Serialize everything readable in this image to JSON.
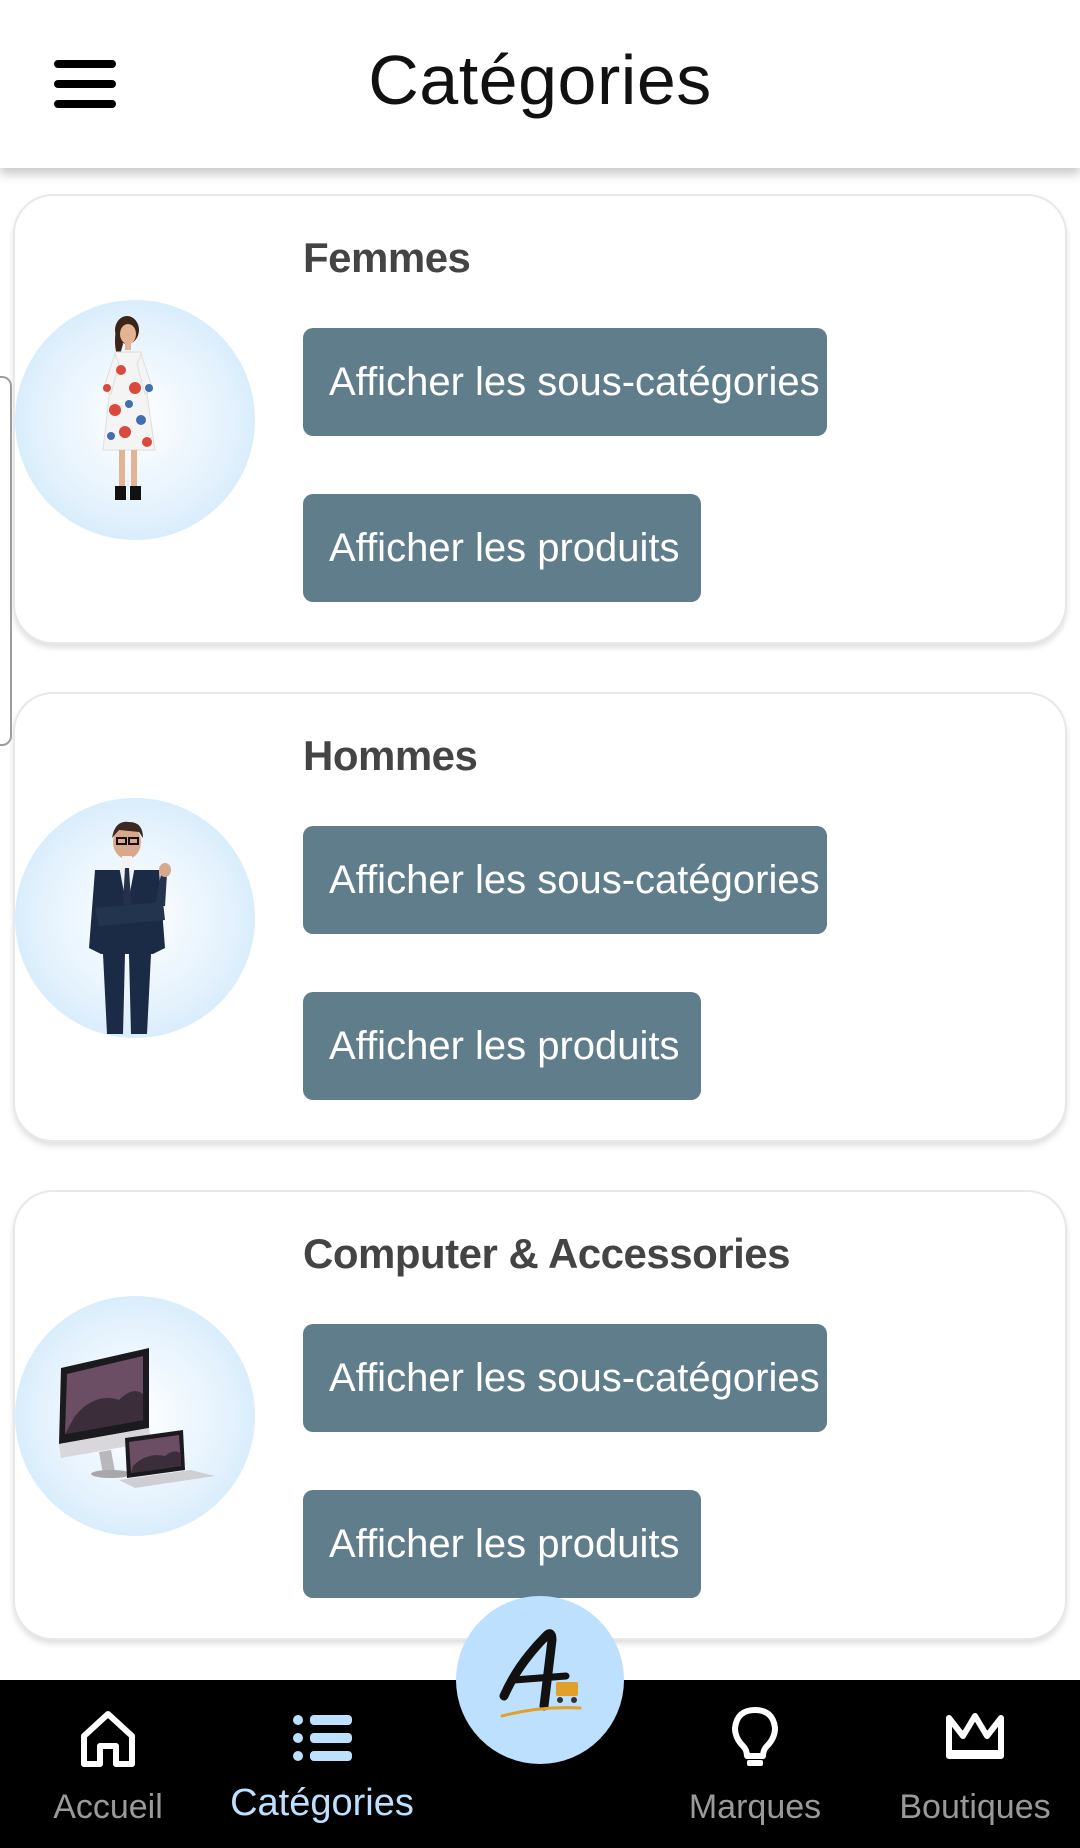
{
  "header": {
    "title": "Catégories",
    "menu_icon": "hamburger-menu-icon"
  },
  "categories": [
    {
      "name": "Femmes",
      "image": "woman-floral-dress-photo",
      "subcategories_label": "Afficher les sous-catégories",
      "products_label": "Afficher les produits"
    },
    {
      "name": "Hommes",
      "image": "man-in-suit-photo",
      "subcategories_label": "Afficher les sous-catégories",
      "products_label": "Afficher les produits"
    },
    {
      "name": "Computer & Accessories",
      "image": "imac-and-macbook-photo",
      "subcategories_label": "Afficher les sous-catégories",
      "products_label": "Afficher les produits"
    }
  ],
  "bottom_nav": {
    "items": [
      {
        "label": "Accueil",
        "icon": "home-icon",
        "active": false
      },
      {
        "label": "Catégories",
        "icon": "list-icon",
        "active": true
      },
      {
        "label": "Marques",
        "icon": "lightbulb-icon",
        "active": false
      },
      {
        "label": "Boutiques",
        "icon": "crown-icon",
        "active": false
      }
    ],
    "center_button_icon": "app-logo-a-cart-icon"
  },
  "colors": {
    "button_bg": "#607d8b",
    "button_text": "#ffffff",
    "nav_bg": "#000000",
    "nav_active": "#bde0fe",
    "nav_inactive": "#9a9a9a",
    "fab_bg": "#bde0fe",
    "avatar_bg": "#d6ecfb"
  }
}
